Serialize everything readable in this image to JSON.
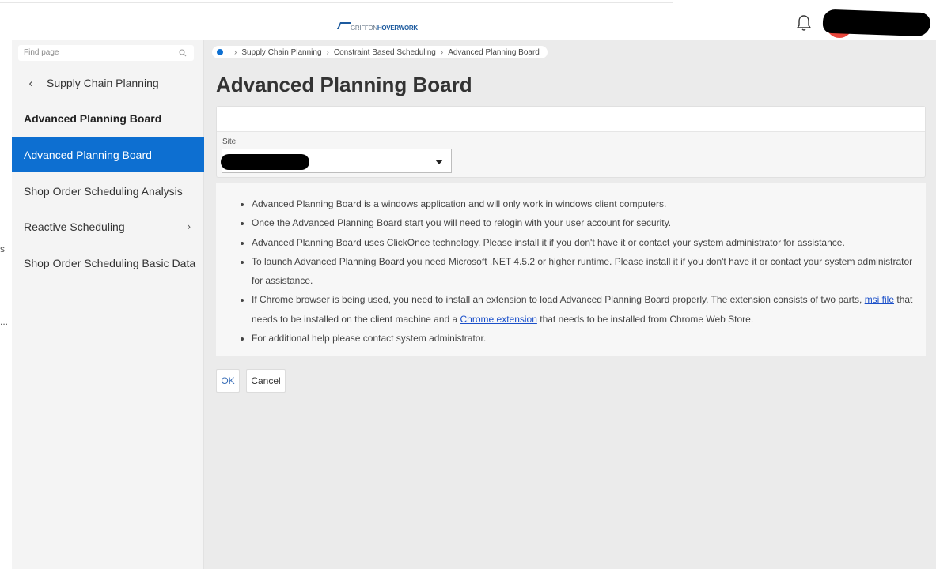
{
  "header": {
    "logo_text_part1": "GRIFFON",
    "logo_text_part2": "HOVERWORK",
    "icons": {
      "notifications": "bell-icon",
      "user": "avatar"
    }
  },
  "sidebar": {
    "search_placeholder": "Find page",
    "back_label": "Supply Chain Planning",
    "section_title": "Advanced Planning Board",
    "items": [
      {
        "label": "Advanced Planning Board",
        "active": true
      },
      {
        "label": "Shop Order Scheduling Analysis"
      },
      {
        "label": "Reactive Scheduling",
        "has_submenu": true
      },
      {
        "label": "Shop Order Scheduling Basic Data"
      }
    ]
  },
  "breadcrumb": [
    "Supply Chain Planning",
    "Constraint Based Scheduling",
    "Advanced Planning Board"
  ],
  "page_title": "Advanced Planning Board",
  "form": {
    "site_label": "Site",
    "site_value": ""
  },
  "info": {
    "line1": "Advanced Planning Board is a windows application and will only work in windows client computers.",
    "line2": "Once the Advanced Planning Board start you will need to relogin with your user account for security.",
    "line3": "Advanced Planning Board uses ClickOnce technology. Please install it if you don't have it or contact your system administrator for assistance.",
    "line4": "To launch Advanced Planning Board you need Microsoft .NET 4.5.2 or higher runtime. Please install it if you don't have it or contact your system administrator for assistance.",
    "line5_a": "If Chrome browser is being used, you need to install an extension to load Advanced Planning Board properly. The extension consists of two parts, ",
    "line5_link1": "msi file",
    "line5_b": " that needs to be installed on the client machine and a ",
    "line5_link2": "Chrome extension",
    "line5_c": " that needs to be installed from Chrome Web Store.",
    "line6": "For additional help please contact system administrator."
  },
  "buttons": {
    "ok": "OK",
    "cancel": "Cancel"
  },
  "colors": {
    "accent": "#0d6fd1",
    "avatar": "#e8463b",
    "link": "#1a4fc9"
  },
  "edge_fragments": {
    "a": "s",
    "b": "..."
  }
}
